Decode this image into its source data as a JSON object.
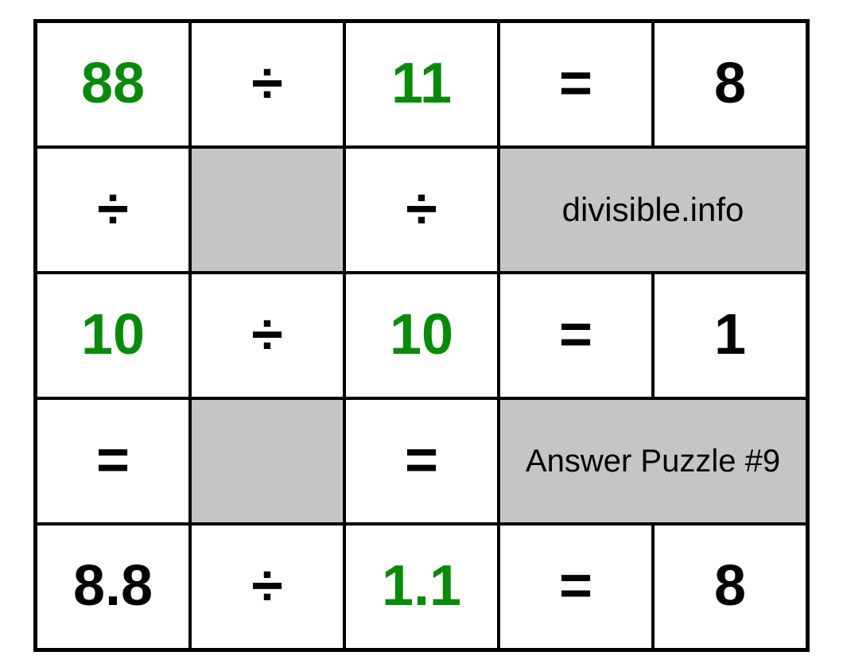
{
  "grid": {
    "r1": {
      "c1": "88",
      "c2": "÷",
      "c3": "11",
      "c4": "=",
      "c5": "8"
    },
    "r2": {
      "c1": "÷",
      "c3": "÷",
      "label": "divisible.info"
    },
    "r3": {
      "c1": "10",
      "c2": "÷",
      "c3": "10",
      "c4": "=",
      "c5": "1"
    },
    "r4": {
      "c1": "=",
      "c3": "=",
      "label": "Answer Puzzle #9"
    },
    "r5": {
      "c1": "8.8",
      "c2": "÷",
      "c3": "1.1",
      "c4": "=",
      "c5": "8"
    }
  }
}
